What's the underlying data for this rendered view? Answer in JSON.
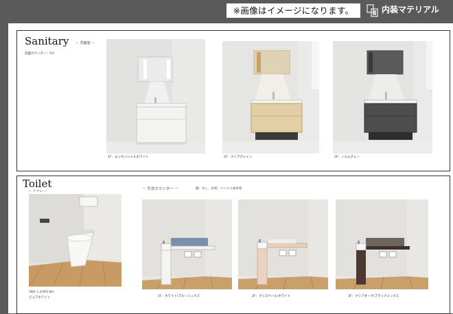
{
  "header": {
    "notice": "※画像はイメージになります。",
    "material_label": "内装マテリアル"
  },
  "sanitary": {
    "title": "Sanitary",
    "subtitle": "－ 洗面室 －",
    "note": "洗面カウンター：GH",
    "items": [
      {
        "caption": "1F：エッセンシャルホワイト",
        "cabinet_color": "#f3f3f1",
        "mirror_color": "#ebebeb"
      },
      {
        "caption": "2F：クリアグレイン",
        "cabinet_color": "#e2cfa6",
        "mirror_color": "#e0d2b4"
      },
      {
        "caption": "3F：ノルムグレー",
        "cabinet_color": "#4d4d4d",
        "mirror_color": "#5a5a5a"
      }
    ]
  },
  "toilet": {
    "title": "Toilet",
    "subtitle": "－ トイレ －",
    "toilet_model": "YBO-Ｌ2HPO-BH",
    "toilet_color": "ピュアホワイト",
    "counter_title": "－ 手洗カウンター －",
    "counter_note": "鏡：なし、水栓：ハンドル式水栓",
    "items": [
      {
        "caption": "1F：ホワイト/ブルーミックス",
        "cabinet_color": "#f4f4f2",
        "tile_color": "#7a8fae",
        "shelf_color": "#f4f4f2"
      },
      {
        "caption": "2F：クリスペール/ホワイト",
        "cabinet_color": "#ecd2c0",
        "tile_color": "#f0efed",
        "shelf_color": "#e9cfb8"
      },
      {
        "caption": "3F：クリアダーク/ブラックミックス",
        "cabinet_color": "#4a3a33",
        "tile_color": "#6b6560",
        "shelf_color": "#3e302a"
      }
    ]
  }
}
